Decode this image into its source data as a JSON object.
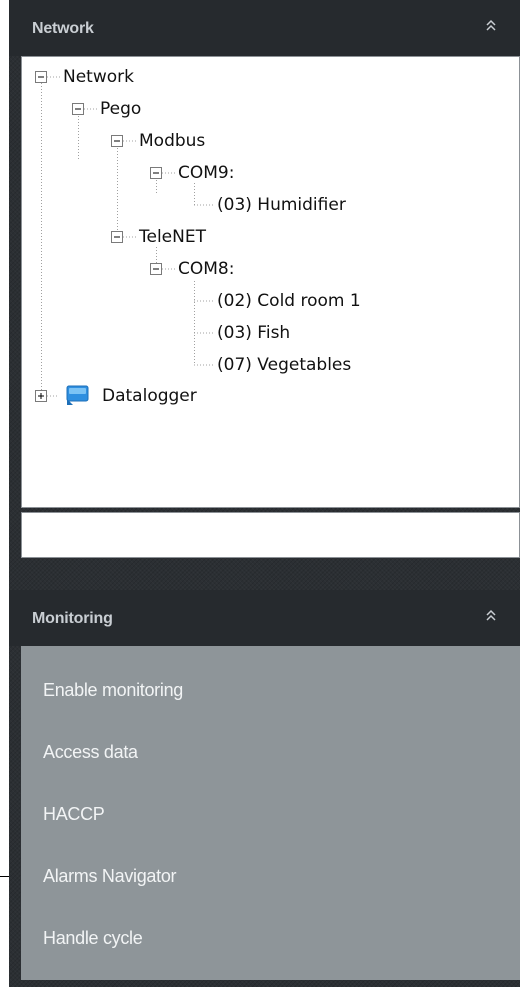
{
  "network_panel": {
    "title": "Network",
    "tree": {
      "root": "Network",
      "pego": "Pego",
      "modbus": "Modbus",
      "com9": "COM9:",
      "humidifier": "(03) Humidifier",
      "telenet": "TeleNET",
      "com8": "COM8:",
      "cold_room": "(02) Cold room 1",
      "fish": "(03) Fish",
      "vegetables": "(07) Vegetables",
      "datalogger": "Datalogger"
    },
    "search_value": ""
  },
  "monitoring_panel": {
    "title": "Monitoring",
    "items": [
      "Enable monitoring",
      "Access data",
      "HACCP",
      "Alarms Navigator",
      "Handle cycle"
    ]
  },
  "colors": {
    "panel_bg": "#2b2f33",
    "menu_bg": "#8e9599",
    "header_text": "#c9ced3"
  }
}
